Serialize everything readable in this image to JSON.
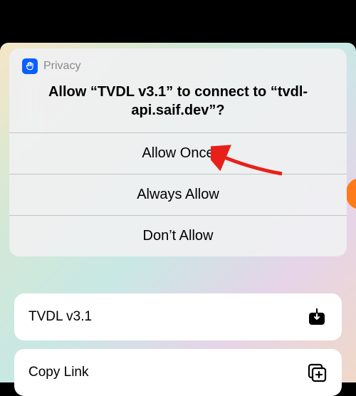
{
  "dialog": {
    "privacy_label": "Privacy",
    "message": "Allow “TVDL v3.1” to connect to “tvdl-api.saif.dev”?",
    "options": {
      "allow_once": "Allow Once",
      "always_allow": "Always Allow",
      "dont_allow": "Don’t Allow"
    }
  },
  "actions": {
    "tvdl": {
      "label": "TVDL v3.1"
    },
    "copy": {
      "label": "Copy Link"
    }
  }
}
